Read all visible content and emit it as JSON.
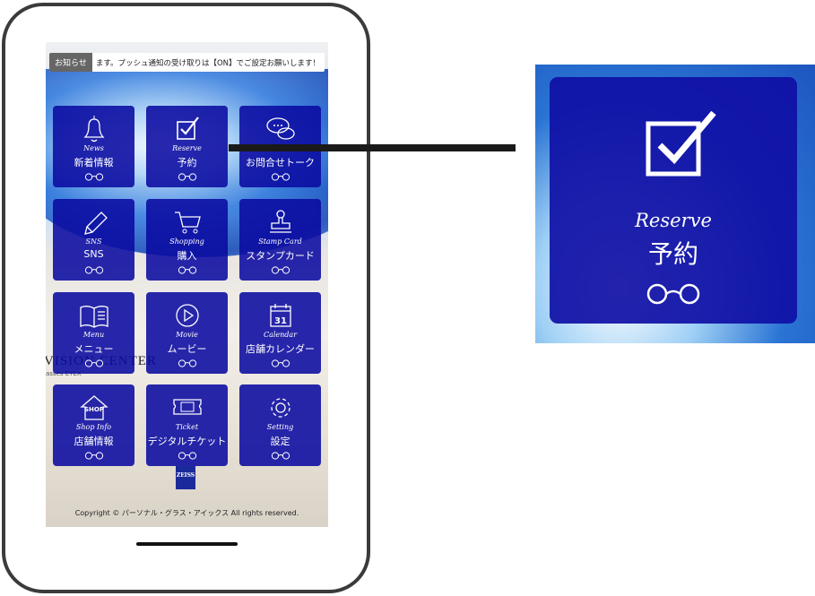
{
  "notice": {
    "tag": "お知らせ",
    "message": "ます。プッシュ通知の受け取りは【ON】でご設定お願いします！"
  },
  "background": {
    "brand": "VISION CENTER",
    "brand_sub": "asses EYEX"
  },
  "tiles": [
    {
      "en": "News",
      "jp": "新着情報",
      "icon": "bell-icon"
    },
    {
      "en": "Reserve",
      "jp": "予約",
      "icon": "checkbox-icon"
    },
    {
      "en": "",
      "jp": "お問合せトーク",
      "icon": "chat-bubbles-icon"
    },
    {
      "en": "SNS",
      "jp": "SNS",
      "icon": "pencil-icon"
    },
    {
      "en": "Shopping",
      "jp": "購入",
      "icon": "cart-icon"
    },
    {
      "en": "Stamp Card",
      "jp": "スタンプカード",
      "icon": "stamp-icon"
    },
    {
      "en": "Menu",
      "jp": "メニュー",
      "icon": "book-icon"
    },
    {
      "en": "Movie",
      "jp": "ムービー",
      "icon": "play-icon"
    },
    {
      "en": "Calendar",
      "jp": "店舗カレンダー",
      "icon": "calendar-icon",
      "icon_text": "31"
    },
    {
      "en": "Shop Info",
      "jp": "店舗情報",
      "icon": "shop-icon",
      "icon_text": "SHOP"
    },
    {
      "en": "Ticket",
      "jp": "デジタルチケット",
      "icon": "ticket-icon"
    },
    {
      "en": "Setting",
      "jp": "設定",
      "icon": "gear-icon"
    }
  ],
  "zeiss": "ZEISS",
  "copyright": "Copyright © パーソナル・グラス・アイックス All rights reserved.",
  "zoom_tile": {
    "en": "Reserve",
    "jp": "予約",
    "icon": "checkbox-icon"
  },
  "colors": {
    "tile": "#0a0aa0",
    "frame": "#3b3b3b"
  }
}
